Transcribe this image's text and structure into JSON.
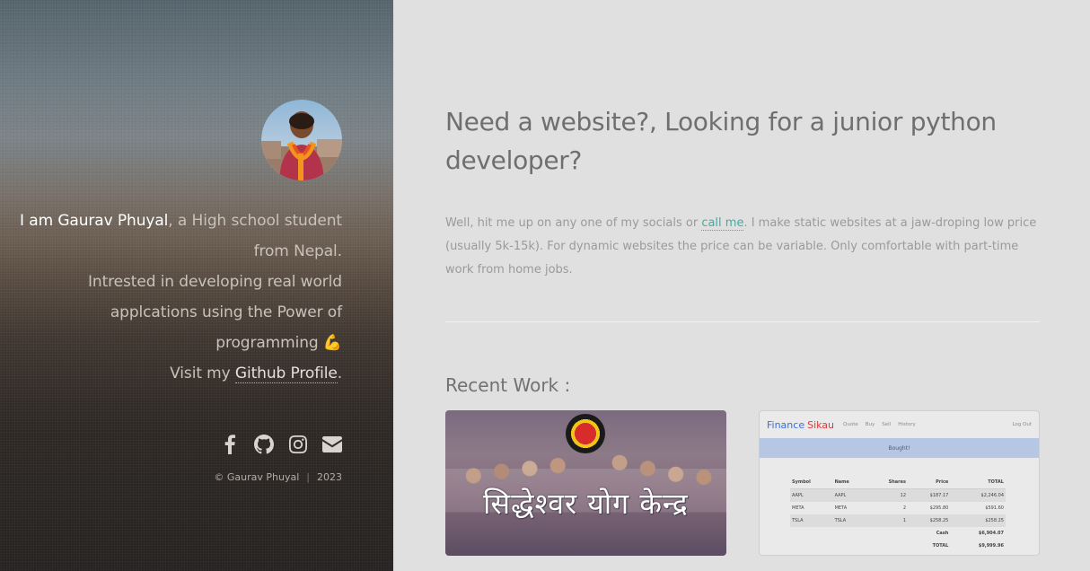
{
  "sidebar": {
    "avatar_alt": "Gaurav Phuyal",
    "bio": {
      "greeting": "I am Gaurav Phuyal",
      "line1_rest": ", a High school student",
      "line2": "from Nepal.",
      "line3": "Intrested in developing real world",
      "line4": "applcations using the Power of",
      "line5": "programming",
      "emoji": "💪",
      "visit_prefix": "Visit my ",
      "github_link": "Github Profile",
      "visit_suffix": "."
    },
    "socials": [
      {
        "name": "facebook-icon"
      },
      {
        "name": "github-icon"
      },
      {
        "name": "instagram-icon"
      },
      {
        "name": "mail-icon"
      }
    ],
    "footer": {
      "copyright": "© Gaurav Phuyal",
      "separator": "|",
      "year": "2023"
    }
  },
  "main": {
    "heading": "Need a website?, Looking for a junior python developer?",
    "intro": {
      "before": "Well, hit me up on any one of my socials or ",
      "call_link": "call me",
      "after": ". I make static websites at a jaw-droping low price (usually 5k-15k). For dynamic websites the price can be variable. Only comfortable with part-time work from home jobs."
    },
    "recent_title": "Recent Work :",
    "works": [
      {
        "title": "सिद्धेश्वर योग केन्द्र"
      },
      {
        "brand_a": "Finance",
        "brand_b": "Sikau",
        "nav": [
          "Quote",
          "Buy",
          "Sell",
          "History"
        ],
        "logout": "Log Out",
        "alert": "Bought!",
        "headers": [
          "Symbol",
          "Name",
          "Shares",
          "Price",
          "TOTAL"
        ],
        "rows": [
          [
            "AAPL",
            "AAPL",
            "12",
            "$187.17",
            "$2,246.04"
          ],
          [
            "META",
            "META",
            "2",
            "$295.80",
            "$591.60"
          ],
          [
            "TSLA",
            "TSLA",
            "1",
            "$258.25",
            "$258.25"
          ]
        ],
        "cash_label": "Cash",
        "cash_value": "$6,904.07",
        "total_label": "TOTAL",
        "total_value": "$9,999.96"
      }
    ]
  },
  "colors": {
    "accent_link": "#4aa8a2",
    "main_bg": "#e0e0e0",
    "finance_blue": "#3d6fd6",
    "finance_red": "#d63a3a"
  }
}
